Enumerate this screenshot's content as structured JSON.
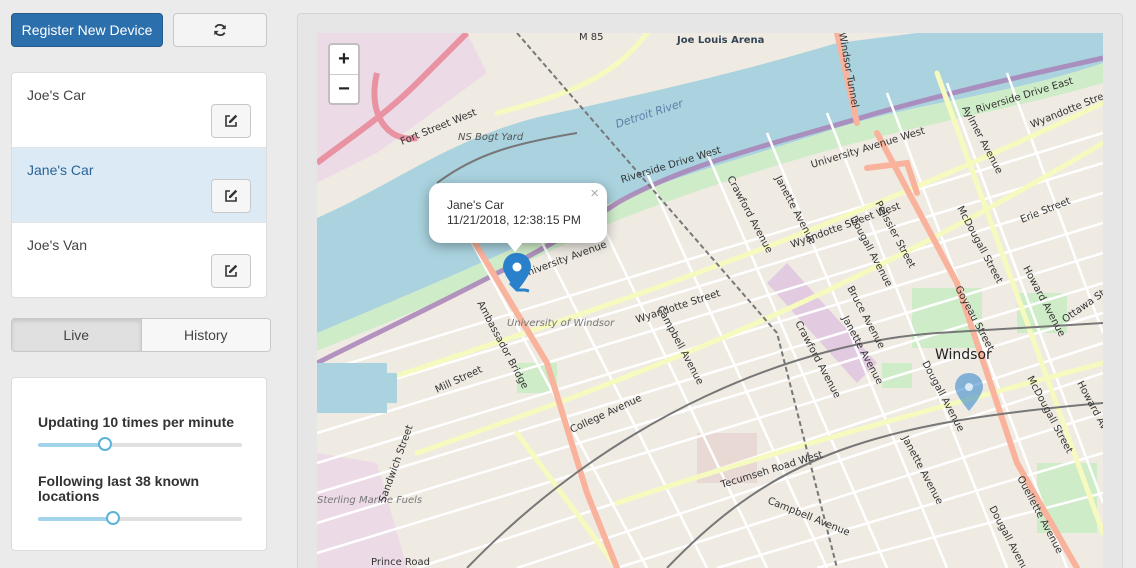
{
  "toolbar": {
    "register_label": "Register New Device",
    "refresh_icon": "refresh-icon"
  },
  "devices": [
    {
      "name": "Joe's Car",
      "edit_icon": "edit-icon"
    },
    {
      "name": "Jane's Car",
      "edit_icon": "edit-icon"
    },
    {
      "name": "Joe's Van",
      "edit_icon": "edit-icon"
    }
  ],
  "mode": {
    "live_label": "Live",
    "history_label": "History",
    "selected": "Live"
  },
  "settings": {
    "update_label": "Updating 10 times per minute",
    "update_value": 0.33,
    "follow_label": "Following last 38 known locations",
    "follow_value": 0.37
  },
  "map": {
    "zoom_in": "+",
    "zoom_out": "−",
    "popup": {
      "device": "Jane's Car",
      "timestamp": "11/21/2018, 12:38:15 PM",
      "close": "×"
    },
    "labels": {
      "city": "Windsor",
      "river": "Detroit River",
      "university": "University of Windsor",
      "arena": "Joe Louis Arena",
      "rail_yard": "NS Bogt Yard",
      "m85": "M 85",
      "sterling": "Sterling Marine Fuels",
      "fort_street": "Fort Street West",
      "riverside_w": "Riverside Drive West",
      "riverside_e": "Riverside Drive East",
      "university_w": "University Avenue",
      "university_w2": "University Avenue West",
      "wyandotte_w": "Wyandotte Street West",
      "wyandotte_e": "Wyandotte Street East",
      "wyandotte": "Wyandotte Street",
      "ambassador": "Ambassador Bridge",
      "mill": "Mill Street",
      "college": "College Avenue",
      "campbell": "Campbell Avenue",
      "crawford": "Crawford Avenue",
      "janette": "Janette Avenue",
      "bruce": "Bruce Avenue",
      "dougall": "Dougall Avenue",
      "pelissier": "Pelissier Street",
      "mcdougall": "McDougall Street",
      "goyeau": "Goyeau Street",
      "howard": "Howard Avenue",
      "ouellette": "Ouellette Avenue",
      "erie": "Erie Street",
      "ottawa": "Ottawa Street",
      "aylmer": "Aylmer Avenue",
      "tecumseh": "Tecumseh Road West",
      "sandwich": "Sandwich Street",
      "tunnel": "Windsor Tunnel",
      "prince": "Prince Road"
    },
    "colors": {
      "water": "#aad3df",
      "land": "#efebe3",
      "marker": "#2a81cb",
      "motorway": "#e892a2",
      "primary": "#f9b29c",
      "secondary": "#f7fabf",
      "boundary": "#a983b8"
    }
  }
}
